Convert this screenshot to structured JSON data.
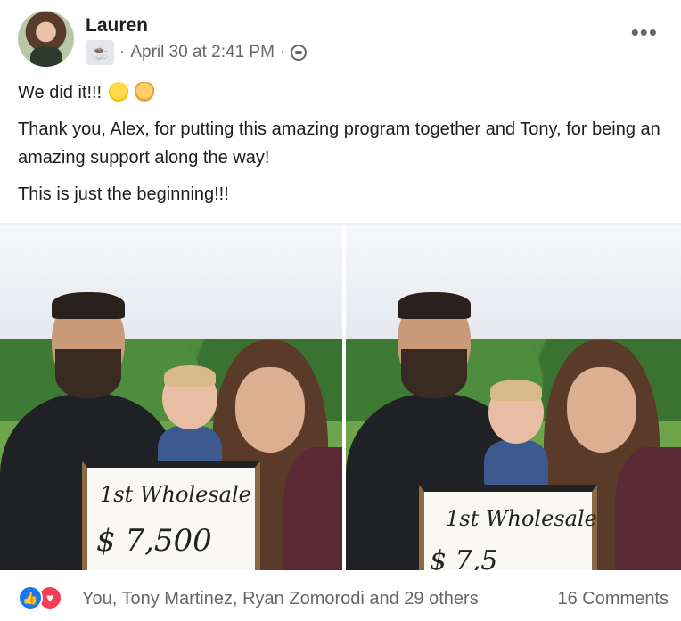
{
  "post": {
    "author": "Lauren",
    "timestamp": "April 30 at 2:41 PM",
    "separator": "·",
    "group_icon": "coffee-cup-icon",
    "audience_icon": "group-audience-icon",
    "more_label": "•••",
    "line1": "We did it!!!",
    "line2": "Thank you, Alex, for putting this amazing program together and Tony, for being an amazing support along the way!",
    "line3": "This is just the beginning!!!"
  },
  "photos": [
    {
      "board_line1": "1st Wholesale",
      "board_line2": "$ 7,500"
    },
    {
      "board_line1": "1st Wholesale",
      "board_line2": "$ 7,5"
    }
  ],
  "reactions": {
    "like_glyph": "👍",
    "love_glyph": "♥",
    "summary": "You, Tony Martinez, Ryan Zomorodi and 29 others",
    "comments": "16 Comments"
  },
  "colors": {
    "like": "#1877f2",
    "love": "#f33e58",
    "secondary_text": "#65676b"
  }
}
